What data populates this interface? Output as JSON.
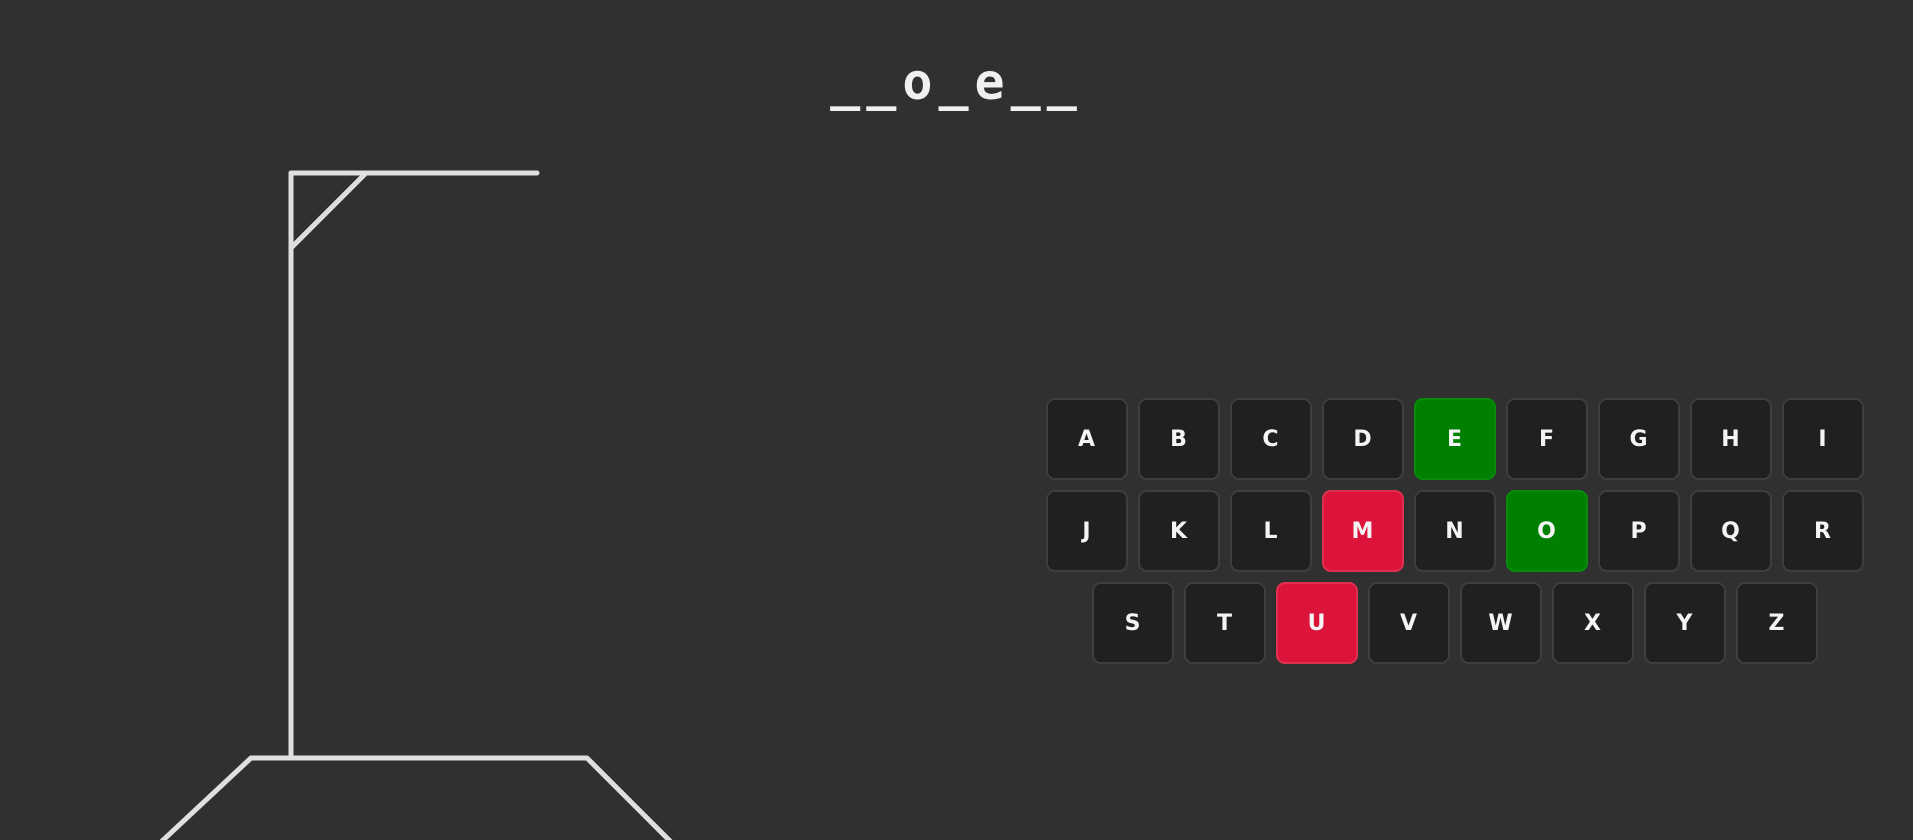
{
  "word_display": "__o_e__",
  "colors": {
    "background": "#303030",
    "key_default": "#202020",
    "key_correct": "#008000",
    "key_wrong": "#dc143c",
    "gallows_stroke": "#e0e0e0"
  },
  "keyboard": {
    "rows": [
      [
        {
          "letter": "A",
          "state": "unused"
        },
        {
          "letter": "B",
          "state": "unused"
        },
        {
          "letter": "C",
          "state": "unused"
        },
        {
          "letter": "D",
          "state": "unused"
        },
        {
          "letter": "E",
          "state": "correct"
        },
        {
          "letter": "F",
          "state": "unused"
        },
        {
          "letter": "G",
          "state": "unused"
        },
        {
          "letter": "H",
          "state": "unused"
        },
        {
          "letter": "I",
          "state": "unused"
        }
      ],
      [
        {
          "letter": "J",
          "state": "unused"
        },
        {
          "letter": "K",
          "state": "unused"
        },
        {
          "letter": "L",
          "state": "unused"
        },
        {
          "letter": "M",
          "state": "wrong"
        },
        {
          "letter": "N",
          "state": "unused"
        },
        {
          "letter": "O",
          "state": "correct"
        },
        {
          "letter": "P",
          "state": "unused"
        },
        {
          "letter": "Q",
          "state": "unused"
        },
        {
          "letter": "R",
          "state": "unused"
        }
      ],
      [
        {
          "letter": "S",
          "state": "unused"
        },
        {
          "letter": "T",
          "state": "unused"
        },
        {
          "letter": "U",
          "state": "wrong"
        },
        {
          "letter": "V",
          "state": "unused"
        },
        {
          "letter": "W",
          "state": "unused"
        },
        {
          "letter": "X",
          "state": "unused"
        },
        {
          "letter": "Y",
          "state": "unused"
        },
        {
          "letter": "Z",
          "state": "unused"
        }
      ]
    ]
  }
}
